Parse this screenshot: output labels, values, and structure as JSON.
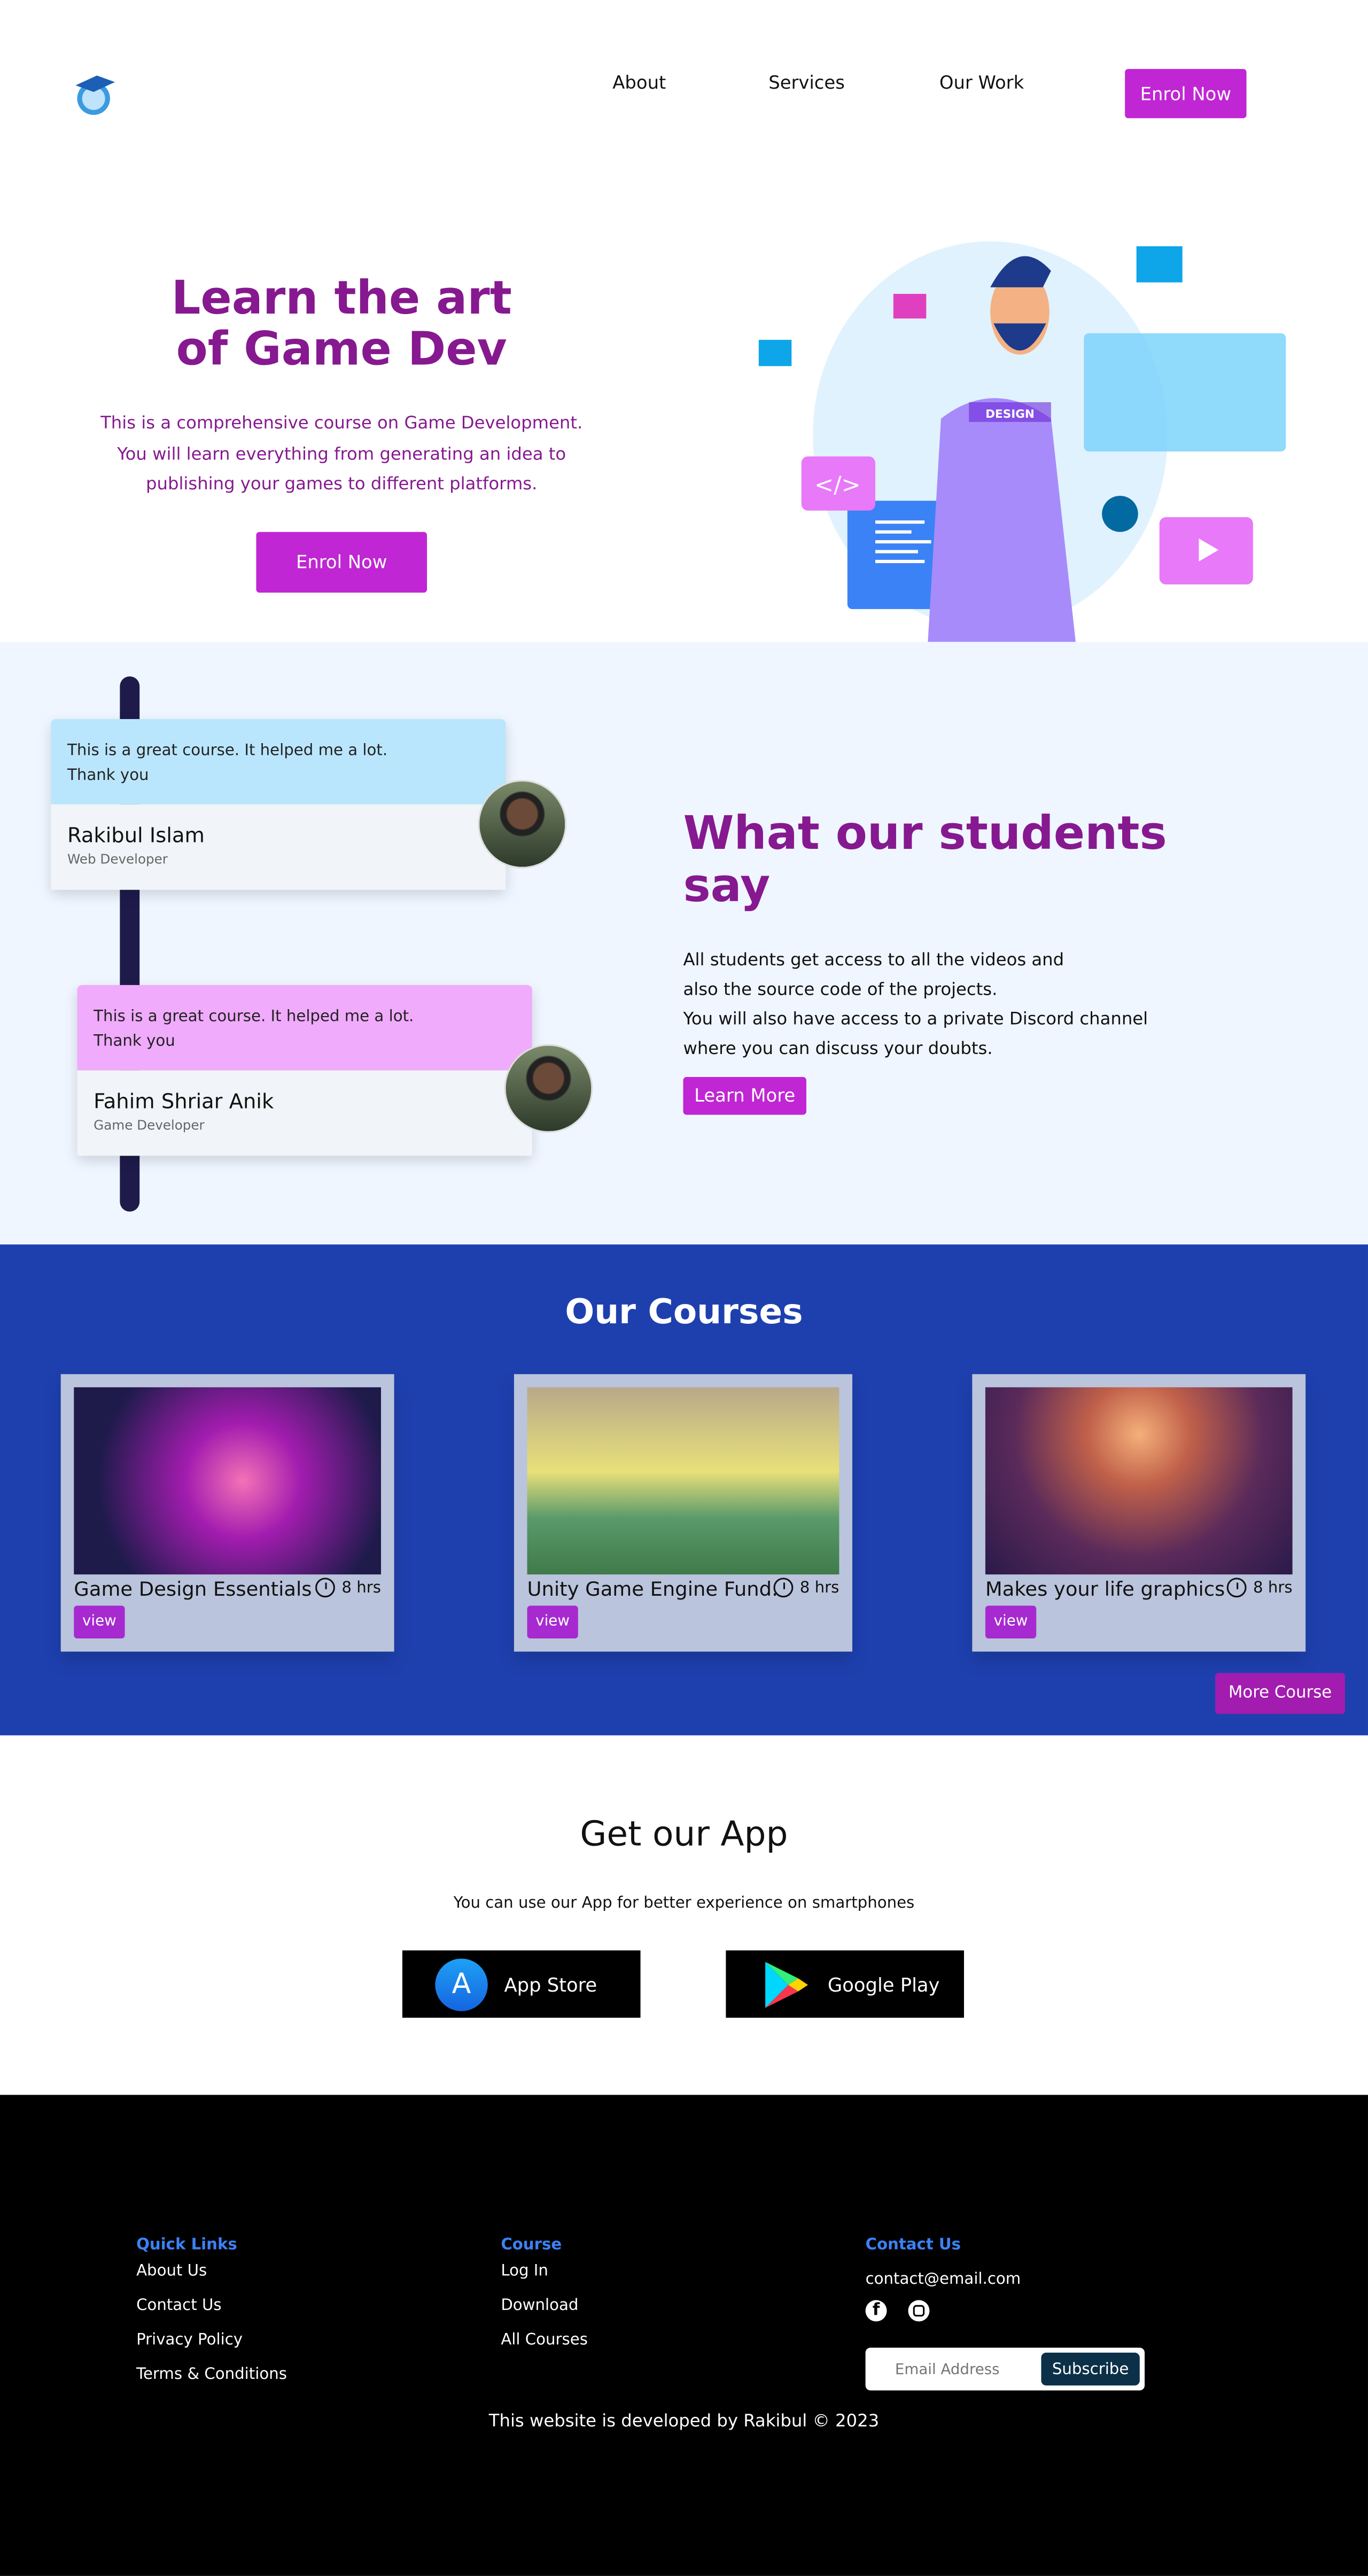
{
  "nav": {
    "logo": "graduation-globe-logo",
    "links": [
      "About",
      "Services",
      "Our Work"
    ],
    "cta": "Enrol Now"
  },
  "hero": {
    "title_line1": "Learn the art",
    "title_line2": "of Game Dev",
    "text": [
      "This is a comprehensive course on Game Development.",
      "You will learn everything from generating an idea to",
      "publishing your games to different platforms."
    ],
    "cta": "Enrol Now",
    "illustration_badge": "DESIGN"
  },
  "testimonials": {
    "items": [
      {
        "quote_line1": "This is a great course. It helped me a lot.",
        "quote_line2": "Thank you",
        "name": "Rakibul Islam",
        "role": "Web Developer"
      },
      {
        "quote_line1": "This is a great course. It helped me a lot.",
        "quote_line2": "Thank you",
        "name": "Fahim Shriar Anik",
        "role": "Game Developer"
      }
    ],
    "heading_line1": "What our students",
    "heading_line2": "say",
    "text": [
      "All students get access to all the videos and",
      "also the source code of the projects.",
      "You will also have access to a private Discord channel",
      "where you can discuss your doubts."
    ],
    "cta": "Learn More"
  },
  "courses": {
    "title": "Our Courses",
    "items": [
      {
        "title": "Game Design Essentials",
        "duration": "8 hrs",
        "button": "view"
      },
      {
        "title": "Unity Game Engine Fund.",
        "duration": "8 hrs",
        "button": "view"
      },
      {
        "title": "Makes your life graphics",
        "duration": "8 hrs",
        "button": "view"
      }
    ],
    "more": "More Course"
  },
  "app": {
    "title": "Get our App",
    "subtitle": "You can use our App for better experience on smartphones",
    "app_store": "App Store",
    "google_play": "Google Play"
  },
  "footer": {
    "quick_links": {
      "title": "Quick Links",
      "items": [
        "About Us",
        "Contact Us",
        "Privacy Policy",
        "Terms & Conditions"
      ]
    },
    "course": {
      "title": "Course",
      "items": [
        "Log In",
        "Download",
        "All Courses"
      ]
    },
    "contact": {
      "title": "Contact Us",
      "email": "contact@email.com",
      "email_placeholder": "Email Address",
      "subscribe": "Subscribe"
    },
    "copyright": "This website is developed by Rakibul © 2023"
  },
  "colors": {
    "primary": "#c026d3",
    "heading": "#86198f",
    "courses_bg": "#1e40af",
    "footer_heading": "#3b82f6"
  }
}
